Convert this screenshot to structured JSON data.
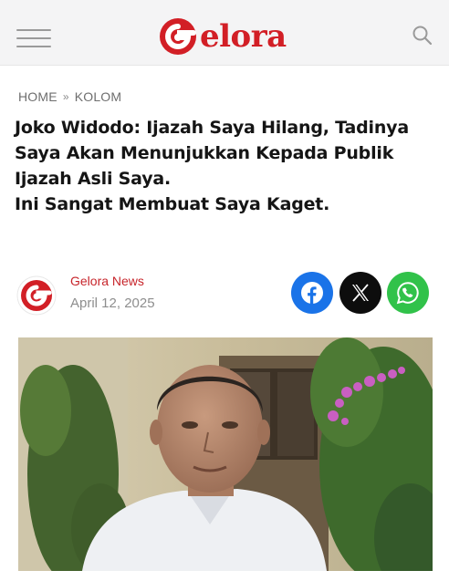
{
  "header": {
    "menu_label": "menu",
    "logo_text": "elora",
    "brand_color": "#d21f26"
  },
  "breadcrumb": {
    "home": "HOME",
    "separator": "»",
    "section": "KOLOM"
  },
  "article": {
    "title_lines": [
      "Joko Widodo: Ijazah Saya Hilang, Tadinya",
      "Saya Akan Menunjukkan Kepada Publik",
      "Ijazah Asli Saya.",
      "Ini Sangat Membuat Saya Kaget."
    ],
    "author": "Gelora News",
    "date": "April 12, 2025"
  },
  "share": {
    "facebook_color": "#1a73e8",
    "x_color": "#0d0d0d",
    "whatsapp_color": "#31c24a"
  },
  "icons": {
    "menu": "hamburger-icon",
    "search": "search-icon",
    "facebook": "facebook-icon",
    "x": "x-icon",
    "whatsapp": "whatsapp-icon"
  }
}
